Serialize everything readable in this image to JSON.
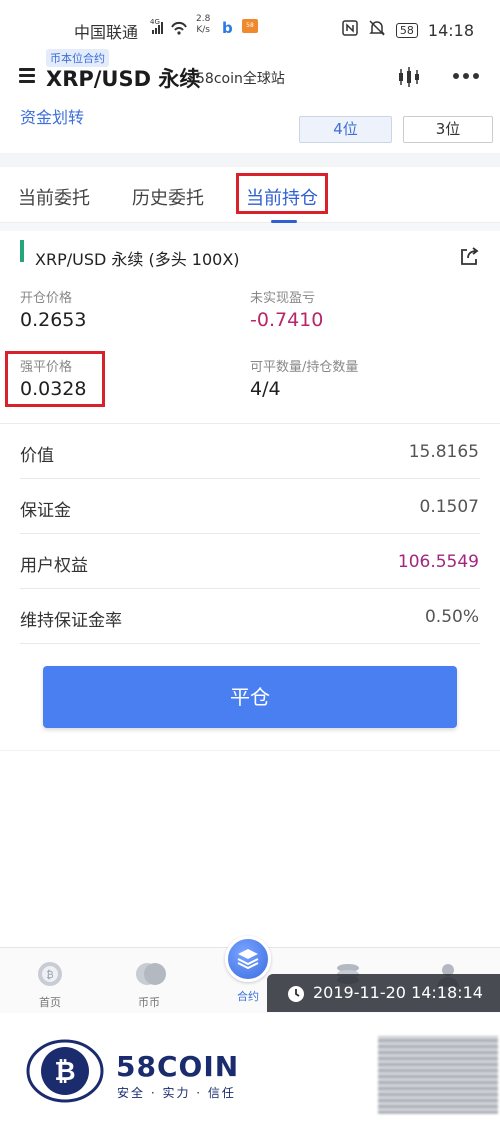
{
  "status_bar": {
    "carrier": "中国联通",
    "network": "4G",
    "speed_value": "2.8",
    "speed_unit": "K/s",
    "mini_app_label": "58",
    "battery": "58",
    "time": "14:18"
  },
  "header": {
    "contract_tag": "币本位合约",
    "title": "XRP/USD 永续",
    "subtitle": "58coin全球站"
  },
  "toolbar": {
    "transfer_label": "资金划转",
    "precision_options": [
      "4位",
      "3位"
    ]
  },
  "tabs": [
    {
      "label": "当前委托"
    },
    {
      "label": "历史委托"
    },
    {
      "label": "当前持仓"
    }
  ],
  "position": {
    "name": "XRP/USD 永续 (多头 100X)",
    "open_price_label": "开仓价格",
    "open_price": "0.2653",
    "unrealized_pnl_label": "未实现盈亏",
    "unrealized_pnl": "-0.7410",
    "liq_price_label": "强平价格",
    "liq_price": "0.0328",
    "closable_label": "可平数量/持仓数量",
    "closable": "4/4"
  },
  "details": [
    {
      "label": "价值",
      "value": "15.8165"
    },
    {
      "label": "保证金",
      "value": "0.1507"
    },
    {
      "label": "用户权益",
      "value": "106.5549"
    },
    {
      "label": "维持保证金率",
      "value": "0.50%"
    }
  ],
  "close_button_label": "平仓",
  "bottom_nav": [
    {
      "label": "首页"
    },
    {
      "label": "币币"
    },
    {
      "label": "合约"
    },
    {
      "label": ""
    },
    {
      "label": ""
    }
  ],
  "timestamp": "2019-11-20 14:18:14",
  "brand": {
    "name": "58COIN",
    "slogan": "安全 · 实力 · 信任"
  },
  "colors": {
    "accent": "#2f5fd0",
    "button": "#4a7ff1",
    "negative": "#b8266a",
    "highlight_box": "#d9212b",
    "long_marker": "#27a57a"
  }
}
